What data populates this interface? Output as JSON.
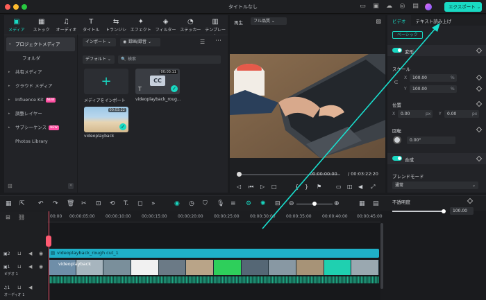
{
  "window": {
    "title": "タイトルなし",
    "export_label": "エクスポート"
  },
  "toolbar": {
    "tabs": [
      {
        "label": "メディア",
        "icon": "media-icon"
      },
      {
        "label": "ストック",
        "icon": "stock-icon"
      },
      {
        "label": "オーディオ",
        "icon": "music-icon"
      },
      {
        "label": "タイトル",
        "icon": "title-icon"
      },
      {
        "label": "トランジション",
        "icon": "transition-icon"
      },
      {
        "label": "エフェクト",
        "icon": "effect-icon"
      },
      {
        "label": "フィルター",
        "icon": "filter-icon"
      },
      {
        "label": "ステッカー",
        "icon": "sticker-icon"
      },
      {
        "label": "テンプレート",
        "icon": "template-icon"
      }
    ]
  },
  "sidebar": {
    "items": [
      {
        "label": "プロジェクトメディア"
      },
      {
        "label": "フォルダ"
      },
      {
        "label": "共有メディア"
      },
      {
        "label": "クラウド メディア"
      },
      {
        "label": "Influence Kit",
        "badge": "NEW"
      },
      {
        "label": "調整レイヤー"
      },
      {
        "label": "サブシーケンス",
        "badge": "NEW"
      },
      {
        "label": "Photos Library"
      }
    ]
  },
  "media": {
    "import_label": "インポート",
    "record_label": "録画/録音",
    "sort_label": "デフォルト",
    "search_placeholder": "検索",
    "import_tile_label": "メディアをインポート",
    "items": [
      {
        "name": "videoplayback_roug...",
        "duration": "00:03:11"
      },
      {
        "name": "videoplayback",
        "duration": "00:03:22"
      }
    ]
  },
  "player": {
    "label": "再生",
    "quality": "フル品質",
    "current_time": "00:00:00:00",
    "total_time": "/ 00:03:22:20"
  },
  "properties": {
    "tabs": [
      "ビデオ",
      "テキスト読み上げ"
    ],
    "basic_label": "ベーシック",
    "transform_label": "変形",
    "scale_label": "スケール",
    "scale_x": "100.00",
    "scale_y": "100.00",
    "position_label": "位置",
    "pos_x": "0.00",
    "pos_y": "0.00",
    "rotation_label": "回転",
    "rotation": "0.00°",
    "composite_label": "合成",
    "blend_label": "ブレンドモード",
    "blend_value": "通常",
    "opacity_label": "不透明度",
    "opacity_value": "100.00",
    "percent_unit": "%",
    "px_unit": "px",
    "x_label": "X",
    "y_label": "Y"
  },
  "timeline": {
    "ruler": [
      "00:00",
      "00:00:05:00",
      "00:00:10:00",
      "00:00:15:00",
      "00:00:20:00",
      "00:00:25:00",
      "00:00:30:00",
      "00:00:35:00",
      "00:00:40:00",
      "00:00:45:00"
    ],
    "cc_clip": "videoplayback_rough cut_1",
    "video_clip": "videoplayback",
    "track2": "2",
    "track1": "1",
    "track1_label": "ビデオ 1",
    "audio_track": "1",
    "audio_label": "オーディオ 1"
  },
  "colors": {
    "accent": "#19d9c3",
    "playhead": "#ff5a72",
    "new_badge": "#ff4fa2"
  }
}
